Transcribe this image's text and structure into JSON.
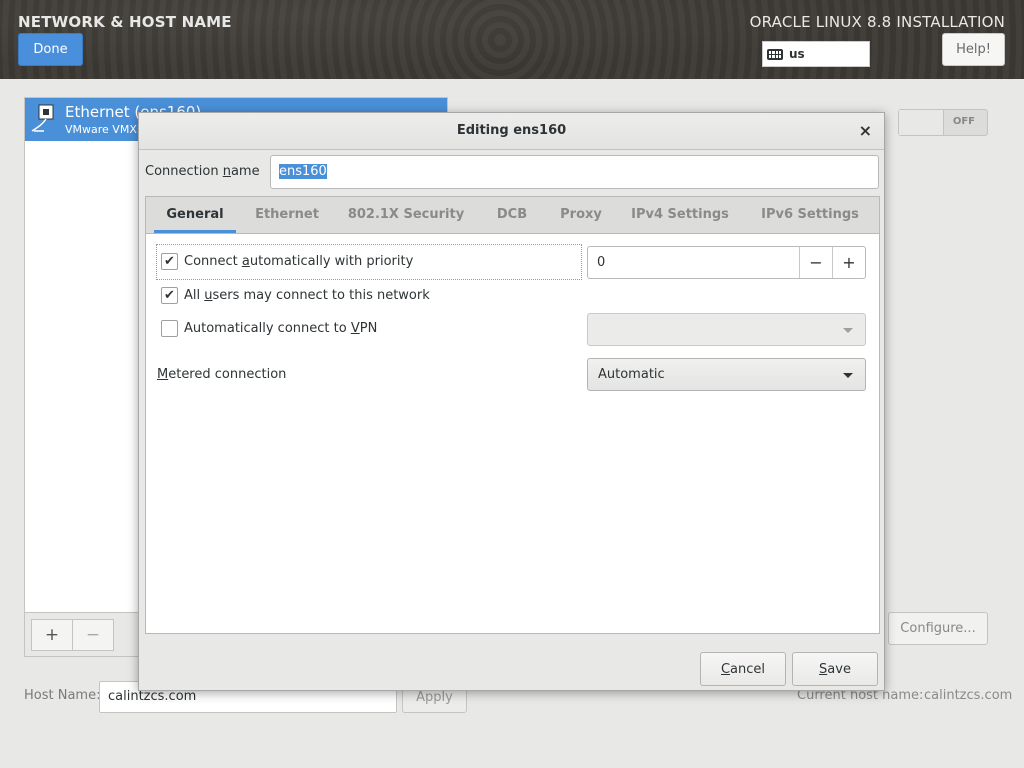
{
  "header": {
    "spoke_title": "NETWORK & HOST NAME",
    "done_label": "Done",
    "product_title": "ORACLE LINUX 8.8 INSTALLATION",
    "keyboard_layout": "us",
    "help_label": "Help!"
  },
  "devices": {
    "items": [
      {
        "name": "Ethernet (ens160)",
        "subtitle": "VMware VMXN"
      }
    ],
    "add_label": "+",
    "remove_label": "−"
  },
  "device_switch": {
    "state": "OFF"
  },
  "configure_label": "Configure...",
  "hostname": {
    "label": "Host Name:",
    "value": "calintzcs.com",
    "apply_label": "Apply",
    "current_label": "Current host name:",
    "current_value": "calintzcs.com"
  },
  "dialog": {
    "title": "Editing ens160",
    "close_glyph": "×",
    "connection_name": {
      "label_pre": "Connection ",
      "label_mnemonic": "n",
      "label_post": "ame",
      "value": "ens160"
    },
    "tabs": [
      {
        "label": "General",
        "active": true
      },
      {
        "label": "Ethernet",
        "active": false
      },
      {
        "label": "802.1X Security",
        "active": false
      },
      {
        "label": "DCB",
        "active": false
      },
      {
        "label": "Proxy",
        "active": false
      },
      {
        "label": "IPv4 Settings",
        "active": false
      },
      {
        "label": "IPv6 Settings",
        "active": false
      }
    ],
    "general": {
      "auto_connect": {
        "pre": "Connect ",
        "mnemonic": "a",
        "post": "utomatically with priority",
        "checked": true,
        "priority": "0"
      },
      "all_users": {
        "pre": "All ",
        "mnemonic": "u",
        "post": "sers may connect to this network",
        "checked": true
      },
      "auto_vpn": {
        "pre": "Automatically connect to ",
        "mnemonic": "V",
        "post": "PN",
        "checked": false,
        "vpn_value": ""
      },
      "metered": {
        "mnemonic": "M",
        "post": "etered connection",
        "value": "Automatic"
      }
    },
    "cancel": {
      "mnemonic": "C",
      "post": "ancel"
    },
    "save": {
      "mnemonic": "S",
      "post": "ave"
    }
  },
  "colors": {
    "accent": "#4a90d9",
    "done_button": "#4a8fdc",
    "header_bg": "#3c3934"
  }
}
